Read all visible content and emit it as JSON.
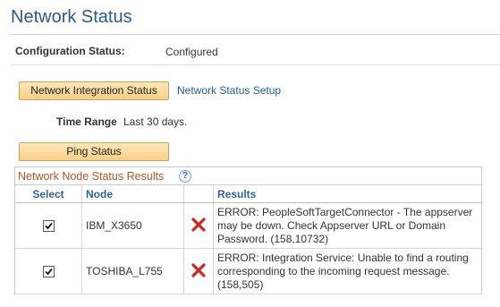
{
  "page": {
    "title": "Network Status"
  },
  "config": {
    "label": "Configuration Status:",
    "value": "Configured"
  },
  "actions": {
    "integration_button": "Network Integration Status",
    "setup_link": "Network Status Setup",
    "ping_button": "Ping Status"
  },
  "time_range": {
    "label": "Time Range",
    "value": "Last 30 days."
  },
  "grid": {
    "title": "Network Node Status Results",
    "help_icon": "question-icon",
    "columns": {
      "select": "Select",
      "node": "Node",
      "results": "Results"
    },
    "rows": [
      {
        "selected": true,
        "node": "IBM_X3650",
        "status_icon": "error-x-icon",
        "result": "ERROR: PeopleSoftTargetConnector - The appserver may be down.  Check Appserver URL or Domain Password. (158,10732)"
      },
      {
        "selected": true,
        "node": "TOSHIBA_L755",
        "status_icon": "error-x-icon",
        "result": "ERROR: Integration Service: Unable to find a routing corresponding to the incoming request message. (158,505)"
      }
    ]
  },
  "colors": {
    "title": "#2b5a8a",
    "link": "#1f5b98",
    "grid_title": "#b5561f",
    "error": "#d0261d",
    "header": "#2c63a0"
  }
}
